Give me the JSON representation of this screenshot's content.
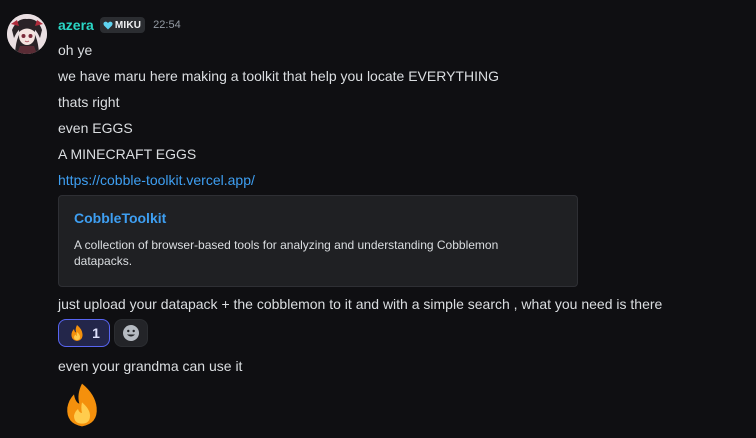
{
  "author": {
    "name": "azera",
    "name_color": "#2ad6c5",
    "tag_icon": "heart-icon",
    "tag": "MIKU",
    "timestamp": "22:54",
    "avatar": "avatar"
  },
  "messages": [
    "oh ye",
    "we have maru here making a toolkit that help you locate EVERYTHING",
    "thats right",
    "even EGGS",
    "A MINECRAFT EGGS"
  ],
  "link": "https://cobble-toolkit.vercel.app/",
  "embed": {
    "title": "CobbleToolkit",
    "description": "A collection of browser-based tools for analyzing and understanding Cobblemon datapacks."
  },
  "message_after_embed": "just upload your datapack + the cobblemon to it and with a simple search , what you need is there",
  "reactions": [
    {
      "icon": "fire-emoji-icon",
      "count": "1",
      "active": true
    }
  ],
  "add_reaction_icon": "smiley-icon",
  "final_message": "even your grandma can use it",
  "jumbo_emoji": "fire-emoji-icon",
  "colors": {
    "background": "#0f0f12",
    "text": "#dbdee1",
    "link": "#3e9ff2",
    "reaction_accent": "#5865f2"
  }
}
